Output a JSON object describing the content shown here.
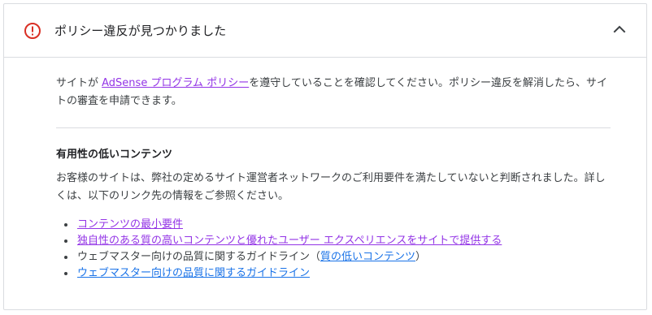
{
  "colors": {
    "alert": "#d93025",
    "link": "#1a73e8",
    "visited_link": "#9334e6",
    "text": "#3c4043",
    "divider": "#dadce0"
  },
  "header": {
    "icon": "exclamation-circle-icon",
    "title": "ポリシー違反が見つかりました",
    "collapse_icon": "chevron-up-icon"
  },
  "intro": {
    "prefix": "サイトが ",
    "link_text": "AdSense プログラム ポリシー",
    "suffix": "を遵守していることを確認してください。ポリシー違反を解消したら、サイトの審査を申請できます。"
  },
  "section": {
    "title": "有用性の低いコンテンツ",
    "description": "お客様のサイトは、弊社の定めるサイト運営者ネットワークのご利用要件を満たしていないと判断されました。詳しくは、以下のリンク先の情報をご参照ください。",
    "items": [
      {
        "text": "コンテンツの最小要件"
      },
      {
        "text": "独自性のある質の高いコンテンツと優れたユーザー エクスペリエンスをサイトで提供する"
      },
      {
        "prefix": "ウェブマスター向けの品質に関するガイドライン（",
        "link_text": "質の低いコンテンツ",
        "suffix": "）"
      },
      {
        "text": "ウェブマスター向けの品質に関するガイドライン"
      }
    ]
  }
}
